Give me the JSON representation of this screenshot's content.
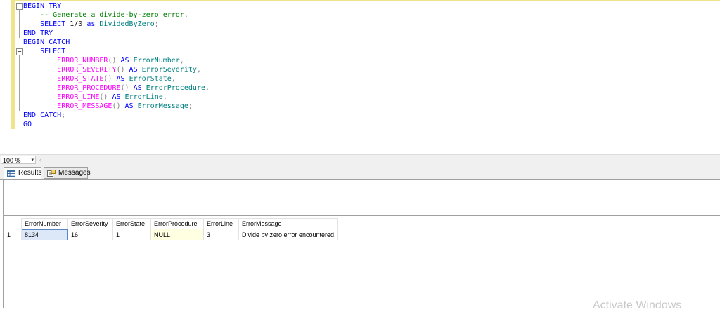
{
  "editor": {
    "lines": [
      [
        {
          "t": "BEGIN TRY",
          "c": "kw"
        }
      ],
      [
        {
          "t": "    "
        },
        {
          "t": "-- Generate a divide-by-zero error.",
          "c": "cm"
        }
      ],
      [
        {
          "t": "    "
        },
        {
          "t": "SELECT",
          "c": "kw"
        },
        {
          "t": " 1/0 "
        },
        {
          "t": "as",
          "c": "kw"
        },
        {
          "t": " "
        },
        {
          "t": "DividedByZero",
          "c": "id"
        },
        {
          "t": ";",
          "c": "gr"
        }
      ],
      [
        {
          "t": "END TRY",
          "c": "kw"
        }
      ],
      [
        {
          "t": "BEGIN CATCH",
          "c": "kw"
        }
      ],
      [
        {
          "t": "    "
        },
        {
          "t": "SELECT",
          "c": "kw"
        }
      ],
      [
        {
          "t": "        "
        },
        {
          "t": "ERROR_NUMBER",
          "c": "fn"
        },
        {
          "t": "()",
          "c": "gr"
        },
        {
          "t": " "
        },
        {
          "t": "AS",
          "c": "kw"
        },
        {
          "t": " "
        },
        {
          "t": "ErrorNumber",
          "c": "id"
        },
        {
          "t": ",",
          "c": "gr"
        }
      ],
      [
        {
          "t": "        "
        },
        {
          "t": "ERROR_SEVERITY",
          "c": "fn"
        },
        {
          "t": "()",
          "c": "gr"
        },
        {
          "t": " "
        },
        {
          "t": "AS",
          "c": "kw"
        },
        {
          "t": " "
        },
        {
          "t": "ErrorSeverity",
          "c": "id"
        },
        {
          "t": ",",
          "c": "gr"
        }
      ],
      [
        {
          "t": "        "
        },
        {
          "t": "ERROR_STATE",
          "c": "fn"
        },
        {
          "t": "()",
          "c": "gr"
        },
        {
          "t": " "
        },
        {
          "t": "AS",
          "c": "kw"
        },
        {
          "t": " "
        },
        {
          "t": "ErrorState",
          "c": "id"
        },
        {
          "t": ",",
          "c": "gr"
        }
      ],
      [
        {
          "t": "        "
        },
        {
          "t": "ERROR_PROCEDURE",
          "c": "fn"
        },
        {
          "t": "()",
          "c": "gr"
        },
        {
          "t": " "
        },
        {
          "t": "AS",
          "c": "kw"
        },
        {
          "t": " "
        },
        {
          "t": "ErrorProcedure",
          "c": "id"
        },
        {
          "t": ",",
          "c": "gr"
        }
      ],
      [
        {
          "t": "        "
        },
        {
          "t": "ERROR_LINE",
          "c": "fn"
        },
        {
          "t": "()",
          "c": "gr"
        },
        {
          "t": " "
        },
        {
          "t": "AS",
          "c": "kw"
        },
        {
          "t": " "
        },
        {
          "t": "ErrorLine",
          "c": "id"
        },
        {
          "t": ",",
          "c": "gr"
        }
      ],
      [
        {
          "t": "        "
        },
        {
          "t": "ERROR_MESSAGE",
          "c": "fn"
        },
        {
          "t": "()",
          "c": "gr"
        },
        {
          "t": " "
        },
        {
          "t": "AS",
          "c": "kw"
        },
        {
          "t": " "
        },
        {
          "t": "ErrorMessage",
          "c": "id"
        },
        {
          "t": ";",
          "c": "gr"
        }
      ],
      [
        {
          "t": "END CATCH",
          "c": "kw"
        },
        {
          "t": ";",
          "c": "gr"
        }
      ],
      [
        {
          "t": "GO",
          "c": "kw"
        }
      ]
    ]
  },
  "zoom": {
    "value": "100 %",
    "arrow": "▾",
    "scroll_left": "‹"
  },
  "tabs": {
    "results": "Results",
    "messages": "Messages"
  },
  "grid": {
    "columns": [
      "ErrorNumber",
      "ErrorSeverity",
      "ErrorState",
      "ErrorProcedure",
      "ErrorLine",
      "ErrorMessage"
    ],
    "rows": [
      {
        "num": "1",
        "cells": [
          "8134",
          "16",
          "1",
          "NULL",
          "3",
          "Divide by zero error encountered."
        ]
      }
    ]
  },
  "watermark": "Activate Windows",
  "colors": {
    "keyword": "#0000ff",
    "function": "#ff00ff",
    "comment": "#008000",
    "identifier": "#008080",
    "change_bar": "#f1e38a"
  },
  "icons": {
    "results_tab": "grid-icon",
    "messages_tab": "messages-icon"
  }
}
